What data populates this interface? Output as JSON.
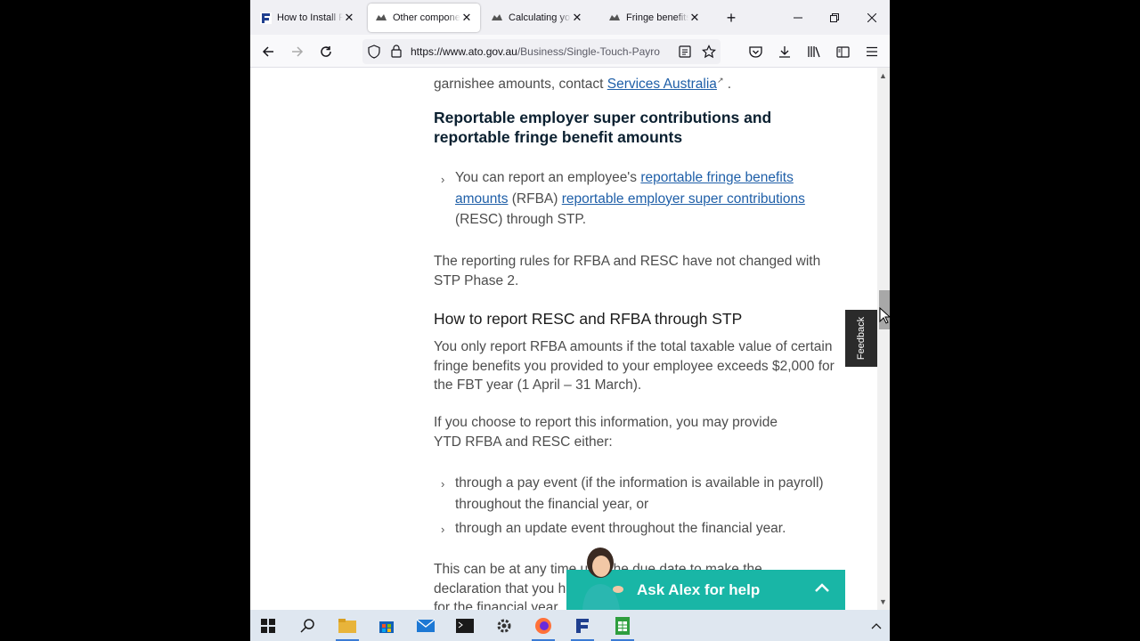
{
  "browser": {
    "tabs": [
      {
        "title": "How to Install Fr",
        "favicon": "F-logo-icon"
      },
      {
        "title": "Other componen",
        "favicon": "ato-crest-icon",
        "active": true
      },
      {
        "title": "Calculating your",
        "favicon": "ato-crest-icon"
      },
      {
        "title": "Fringe benefits ta",
        "favicon": "ato-crest-icon"
      }
    ],
    "url_domain": "https://www.ato.gov.au",
    "url_path": "/Business/Single-Touch-Payro"
  },
  "content": {
    "top_line_text": "garnishee amounts, contact",
    "top_line_link": "Services Australia",
    "top_line_end": ".",
    "section_heading": "Reportable employer super contributions and reportable fringe benefit amounts",
    "bullet1_pre": "You can report an employee's",
    "bullet1_link1": "reportable fringe benefits amounts",
    "bullet1_mid": "(RFBA)",
    "bullet1_link2": "reportable employer super contributions",
    "bullet1_post": "(RESC) through STP.",
    "para1": "The reporting rules for RFBA and RESC have not changed with STP Phase  2.",
    "subheading": "How to report RESC and RFBA through STP",
    "para2": "You only report RFBA amounts if the total taxable value of certain fringe benefits you provided to your employee exceeds $2,000 for the FBT  year (1  April  – 31  March).",
    "para3": "If you choose to report this information, you may provide YTD  RFBA and RESC either:",
    "bullet2": "through a pay event (if the information is available in payroll) throughout the financial year, or",
    "bullet3": "through an update event throughout the financial year.",
    "para4_line1": "This can be at any time until the due date to make the",
    "para4_line2": "declaration that you have provided a finalisation event",
    "para4_line3": "for the financial year."
  },
  "feedback_label": "Feedback",
  "ask_alex_label": "Ask Alex for help",
  "colors": {
    "link": "#1f5fa8",
    "alex_bg": "#19b6a6",
    "heading": "#0b2030"
  }
}
